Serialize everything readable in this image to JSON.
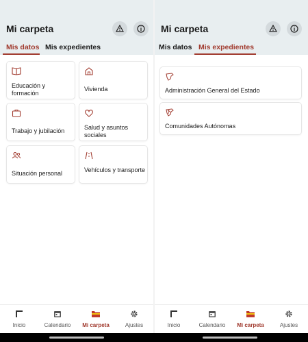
{
  "colors": {
    "accent": "#a13b2f",
    "header_bg": "#e8eef0"
  },
  "left": {
    "title": "Mi carpeta",
    "tabs": [
      "Mis datos",
      "Mis expedientes"
    ],
    "cards": [
      {
        "label": "Educación y formación",
        "icon": "book-icon"
      },
      {
        "label": "Vivienda",
        "icon": "home-icon"
      },
      {
        "label": "Trabajo y jubilación",
        "icon": "briefcase-icon"
      },
      {
        "label": "Salud y asuntos sociales",
        "icon": "heart-icon"
      },
      {
        "label": "Situación personal",
        "icon": "people-icon"
      },
      {
        "label": "Vehículos y transporte",
        "icon": "road-icon"
      }
    ]
  },
  "right": {
    "title": "Mi carpeta",
    "tabs": [
      "Mis datos",
      "Mis expedientes"
    ],
    "cards": [
      {
        "label": "Administración General del Estado",
        "icon": "spain-map-icon"
      },
      {
        "label": "Comunidades Autónomas",
        "icon": "spain-regions-icon"
      }
    ]
  },
  "nav": [
    "Inicio",
    "Calendario",
    "Mi carpeta",
    "Ajustes"
  ]
}
